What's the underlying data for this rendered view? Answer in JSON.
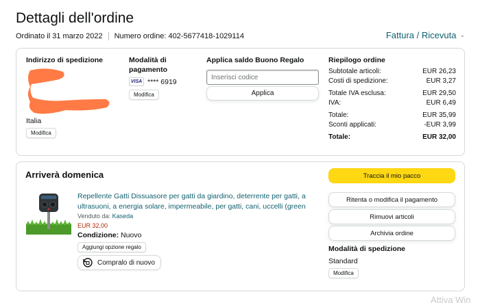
{
  "header": {
    "title": "Dettagli dell'ordine",
    "order_date": "Ordinato il 31 marzo 2022",
    "order_number": "Numero ordine: 402-5677418-1029114",
    "invoice_link": "Fattura / Ricevuta"
  },
  "shipping_address": {
    "title": "Indirizzo di spedizione",
    "country": "Italia",
    "edit_label": "Modifica"
  },
  "payment": {
    "title": "Modalità di pagamento",
    "card_brand": "VISA",
    "card_digits": "**** 6919",
    "edit_label": "Modifica"
  },
  "gift_card": {
    "title": "Applica saldo Buono Regalo",
    "placeholder": "Inserisci codice",
    "apply_label": "Applica"
  },
  "summary": {
    "title": "Riepilogo ordine",
    "rows": [
      {
        "label": "Subtotale articoli:",
        "value": "EUR 26,23"
      },
      {
        "label": "Costi di spedizione:",
        "value": "EUR 3,27"
      },
      {
        "label": "Totale IVA esclusa:",
        "value": "EUR 29,50"
      },
      {
        "label": "IVA:",
        "value": "EUR 6,49"
      },
      {
        "label": "Totale:",
        "value": "EUR 35,99"
      },
      {
        "label": "Sconti applicati:",
        "value": "-EUR 3,99"
      },
      {
        "label": "Totale:",
        "value": "EUR 32,00"
      }
    ]
  },
  "shipment": {
    "arrival": "Arriverà domenica",
    "product_title": "Repellente Gatti Dissuasore per gatti da giardino, deterrente per gatti, a ultrasuoni, a energia solare, impermeabile, per gatti, cani, uccelli (green",
    "sold_by_label": "Venduto da:",
    "seller": "Kaseda",
    "price": "EUR 32,00",
    "condition_label": "Condizione:",
    "condition_value": "Nuovo",
    "gift_option_label": "Aggiungi opzione regalo",
    "buy_again_label": "Compralo di nuovo",
    "track_label": "Traccia il mio pacco",
    "retry_payment_label": "Ritenta o modifica il pagamento",
    "remove_items_label": "Rimuovi articoli",
    "archive_label": "Archivia ordine",
    "shipping_method_title": "Modalità di spedizione",
    "shipping_method_value": "Standard",
    "shipping_edit_label": "Modifica"
  },
  "colors": {
    "link": "#0f5f6e",
    "price": "#b12704",
    "primary_button": "#ffd814",
    "redaction": "#ff7a45",
    "border": "#d5d9d9"
  },
  "watermark": "Attiva Win"
}
